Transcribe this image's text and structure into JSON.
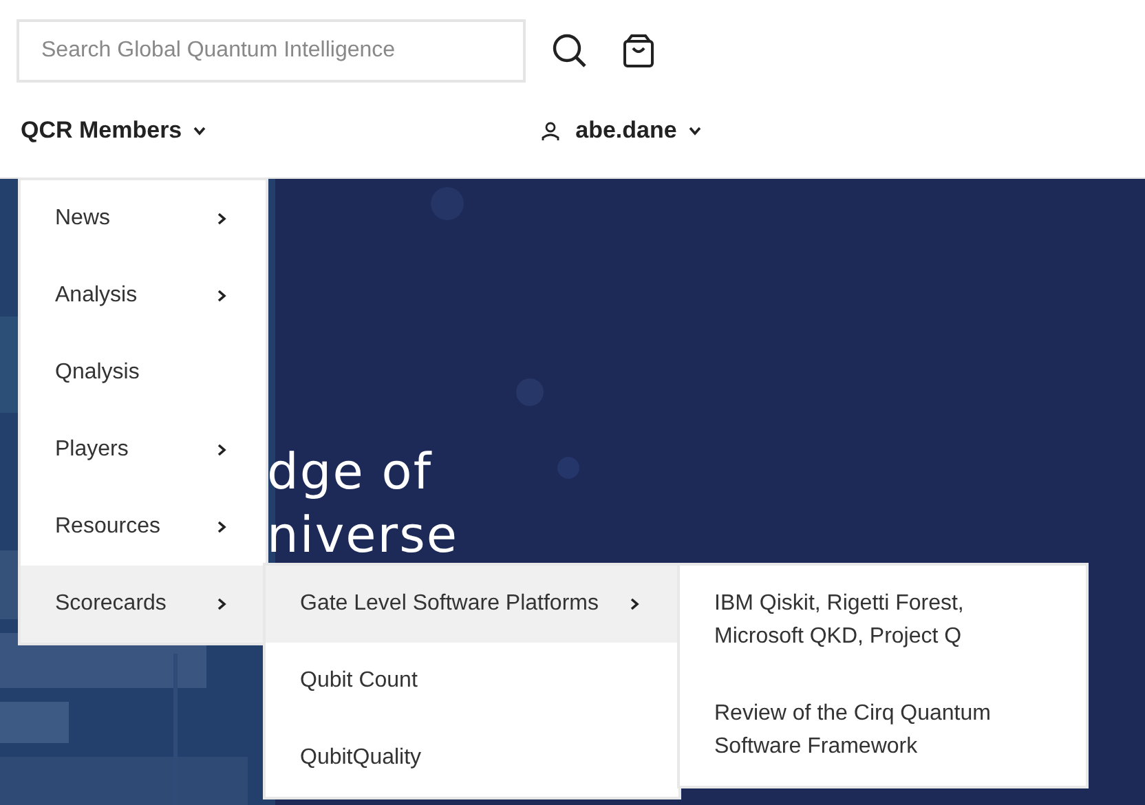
{
  "search": {
    "placeholder": "Search Global Quantum Intelligence"
  },
  "nav": {
    "members_menu": "QCR Members",
    "user": "abe.dane"
  },
  "hero": {
    "kind": "picture",
    "lines": [
      {
        "parts": [
          "dge of"
        ]
      },
      {
        "parts": [
          "niverse"
        ]
      }
    ]
  },
  "menu": {
    "items": [
      {
        "label": "News",
        "has_submenu": true,
        "selected": false
      },
      {
        "label": "Analysis",
        "has_submenu": true,
        "selected": false
      },
      {
        "label": "Qnalysis",
        "has_submenu": false,
        "selected": false
      },
      {
        "label": "Players",
        "has_submenu": true,
        "selected": false
      },
      {
        "label": "Resources",
        "has_submenu": true,
        "selected": false
      },
      {
        "label": "Scorecards",
        "has_submenu": true,
        "selected": true
      }
    ]
  },
  "submenu": {
    "items": [
      {
        "label": "Gate Level Software Platforms",
        "has_submenu": true,
        "selected": true
      },
      {
        "label": "Qubit Count",
        "has_submenu": false,
        "selected": false
      },
      {
        "label": "QubitQuality",
        "has_submenu": false,
        "selected": false
      }
    ]
  },
  "flyout": {
    "items": [
      {
        "label": "IBM Qiskit, Rigetti Forest, Microsoft QKD, Project Q"
      },
      {
        "label": "Review of the Cirq Quantum Software Framework"
      }
    ]
  }
}
